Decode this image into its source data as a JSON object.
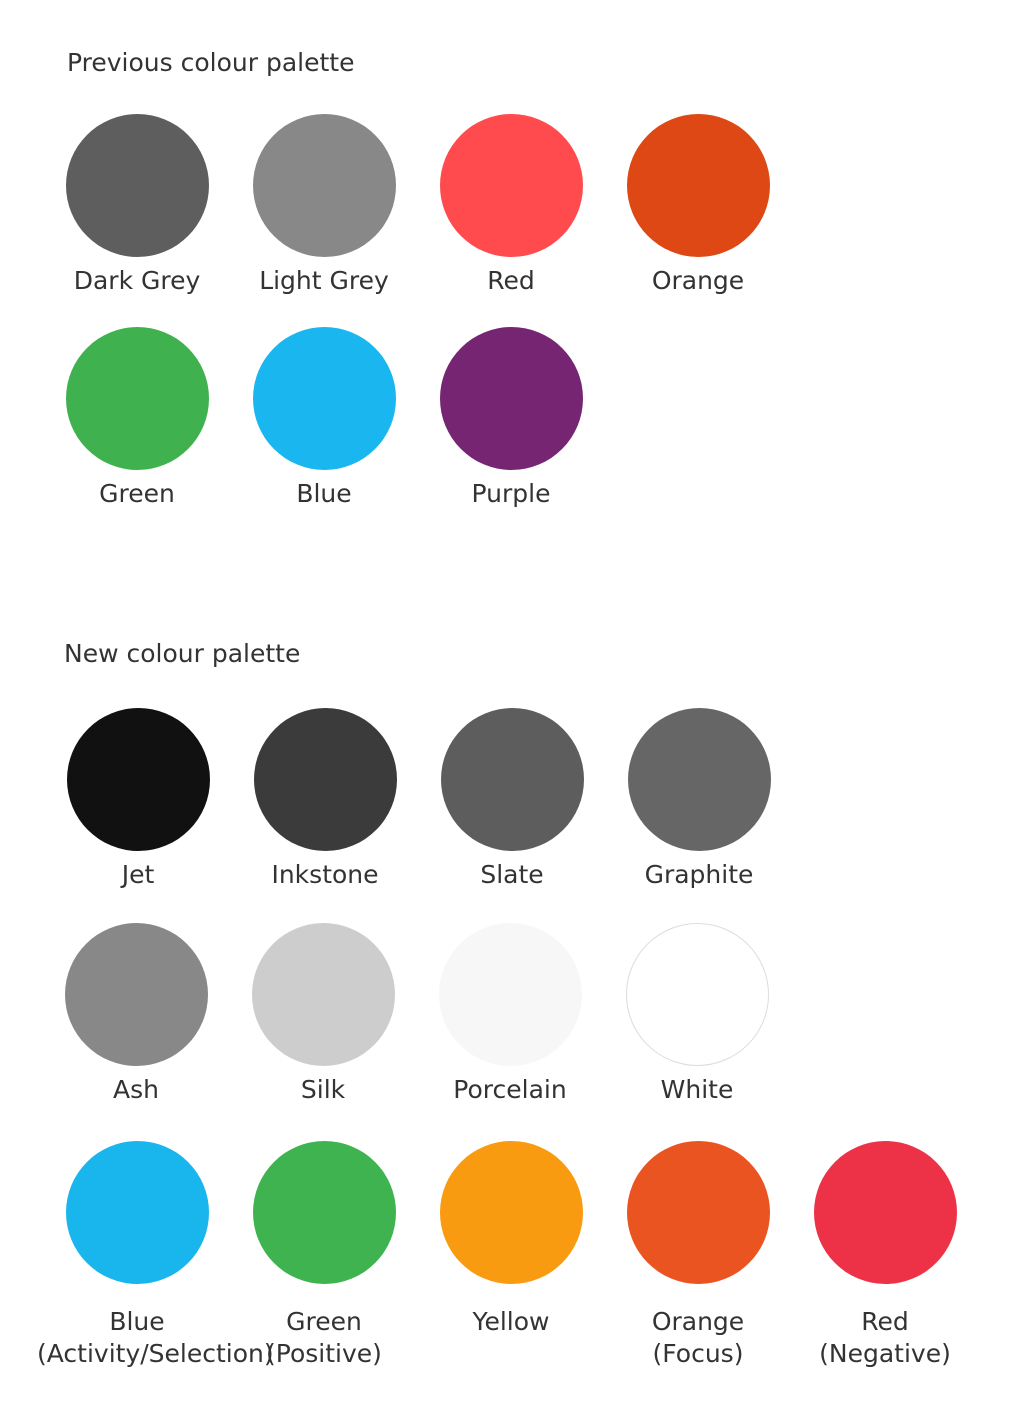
{
  "previous": {
    "heading": "Previous colour palette",
    "swatches": [
      {
        "name": "Dark Grey",
        "sub": "",
        "color": "#5e5e5e"
      },
      {
        "name": "Light Grey",
        "sub": "",
        "color": "#888888"
      },
      {
        "name": "Red",
        "sub": "",
        "color": "#ff4b4e"
      },
      {
        "name": "Orange",
        "sub": "",
        "color": "#dd4814"
      },
      {
        "name": "Green",
        "sub": "",
        "color": "#3fb24f"
      },
      {
        "name": "Blue",
        "sub": "",
        "color": "#1ab6ef"
      },
      {
        "name": "Purple",
        "sub": "",
        "color": "#762572"
      }
    ]
  },
  "new": {
    "heading": "New colour palette",
    "swatches": [
      {
        "name": "Jet",
        "sub": "",
        "color": "#111111"
      },
      {
        "name": "Inkstone",
        "sub": "",
        "color": "#3b3b3b"
      },
      {
        "name": "Slate",
        "sub": "",
        "color": "#5d5d5d"
      },
      {
        "name": "Graphite",
        "sub": "",
        "color": "#666666"
      },
      {
        "name": "Ash",
        "sub": "",
        "color": "#888888"
      },
      {
        "name": "Silk",
        "sub": "",
        "color": "#cdcdcd"
      },
      {
        "name": "Porcelain",
        "sub": "",
        "color": "#f7f7f7"
      },
      {
        "name": "White",
        "sub": "",
        "color": "#ffffff"
      },
      {
        "name": "Blue",
        "sub": "(Activity/Selection)",
        "color": "#19b6ee"
      },
      {
        "name": "Green",
        "sub": "(Positive)",
        "color": "#3eb34f"
      },
      {
        "name": "Yellow",
        "sub": "",
        "color": "#f99b11"
      },
      {
        "name": "Orange",
        "sub": "(Focus)",
        "color": "#e95420"
      },
      {
        "name": "Red",
        "sub": "(Negative)",
        "color": "#ed3146"
      }
    ]
  }
}
